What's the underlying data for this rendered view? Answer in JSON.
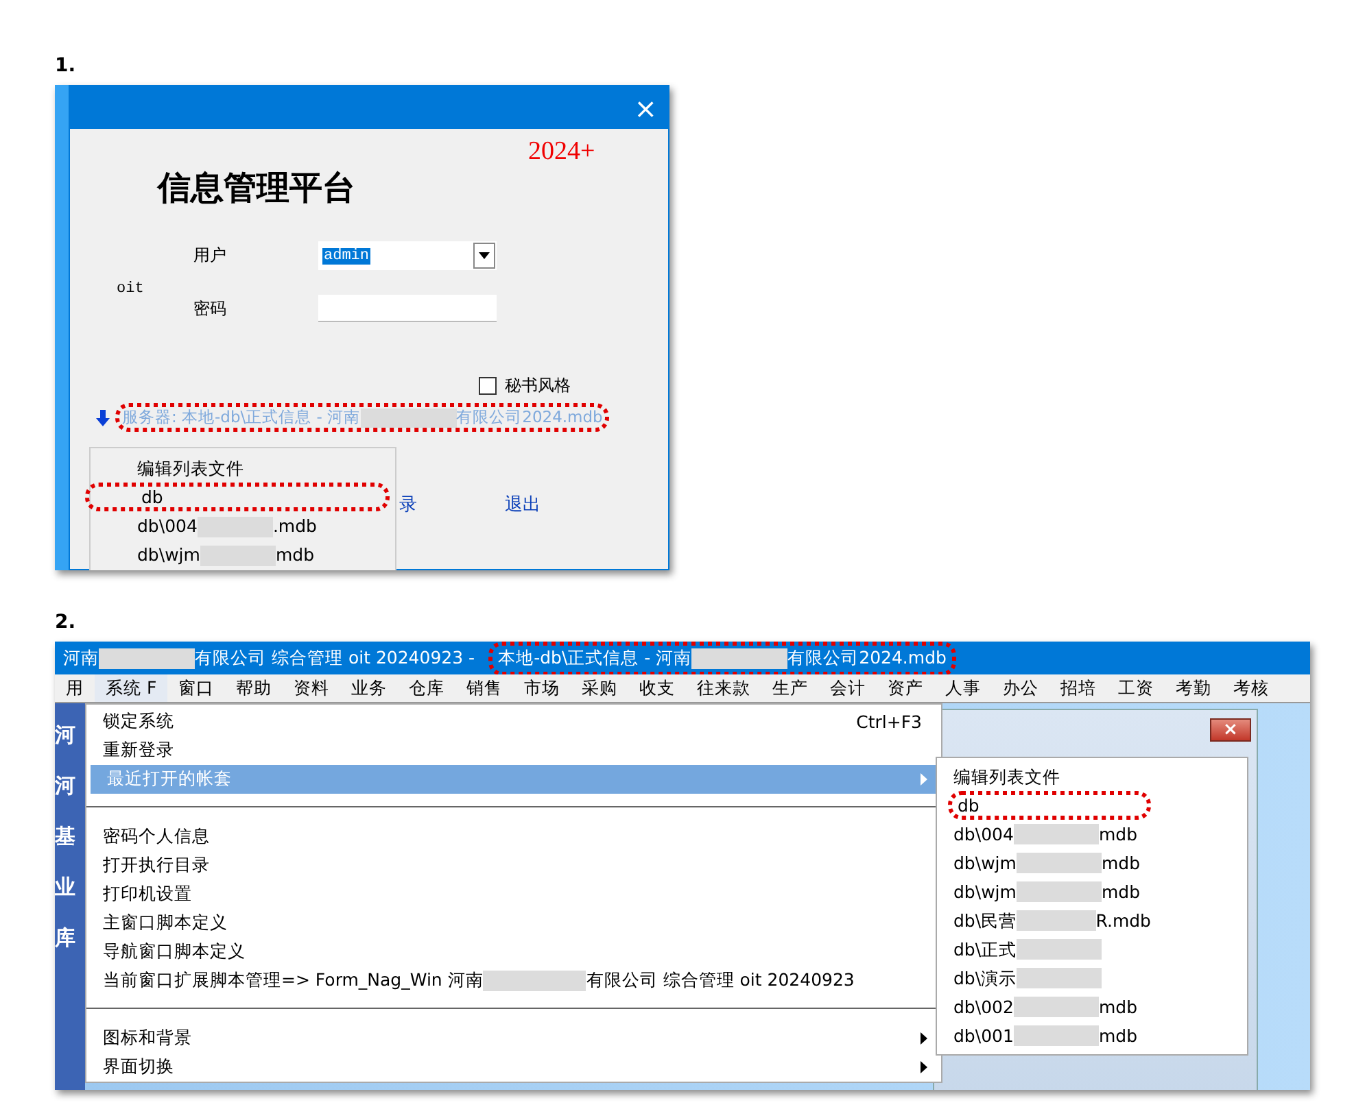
{
  "step_1": {
    "number": "1.",
    "dialog": {
      "close": "×",
      "version": "2024+",
      "title": "信息管理平台",
      "user_label": "用户",
      "user_value": "admin",
      "oit": "oit",
      "password_label": "密码",
      "checkbox": {
        "label": "秘书风格",
        "checked": false
      },
      "server": {
        "highlighted": true,
        "segments": [
          {
            "kind": "text",
            "text": "服务器: 本地-db\\正式信息 - 河南"
          },
          {
            "kind": "redacted"
          },
          {
            "kind": "text",
            "text": "有限公司2024.mdb"
          }
        ]
      },
      "dropdown": [
        {
          "highlighted": false,
          "segments": [
            {
              "kind": "text",
              "text": "编辑列表文件"
            }
          ]
        },
        {
          "highlighted": true,
          "segments": [
            {
              "kind": "text",
              "text": "db"
            }
          ]
        },
        {
          "highlighted": false,
          "segments": [
            {
              "kind": "text",
              "text": "db\\004"
            },
            {
              "kind": "redacted"
            },
            {
              "kind": "text",
              "text": ".mdb"
            }
          ]
        },
        {
          "highlighted": false,
          "segments": [
            {
              "kind": "text",
              "text": "db\\wjm"
            },
            {
              "kind": "redacted"
            },
            {
              "kind": "text",
              "text": "mdb"
            }
          ]
        }
      ],
      "login": "录",
      "exit": "退出"
    }
  },
  "step_2": {
    "number": "2.",
    "title_parts": [
      {
        "highlighted": false,
        "segments": [
          {
            "kind": "text",
            "text": "河南"
          },
          {
            "kind": "redacted"
          },
          {
            "kind": "text",
            "text": "有限公司 综合管理 oit 20240923 -"
          }
        ]
      },
      {
        "highlighted": true,
        "segments": [
          {
            "kind": "text",
            "text": "本地-db\\正式信息 - 河南"
          },
          {
            "kind": "redacted"
          },
          {
            "kind": "text",
            "text": "有限公司2024.mdb"
          }
        ]
      }
    ],
    "menubar": [
      {
        "label": "用",
        "selected": false
      },
      {
        "label": "系统 F",
        "selected": true
      },
      {
        "label": "窗口",
        "selected": false
      },
      {
        "label": "帮助",
        "selected": false
      },
      {
        "label": "资料",
        "selected": false
      },
      {
        "label": "业务",
        "selected": false
      },
      {
        "label": "仓库",
        "selected": false
      },
      {
        "label": "销售",
        "selected": false
      },
      {
        "label": "市场",
        "selected": false
      },
      {
        "label": "采购",
        "selected": false
      },
      {
        "label": "收支",
        "selected": false
      },
      {
        "label": "往来款",
        "selected": false
      },
      {
        "label": "生产",
        "selected": false
      },
      {
        "label": "会计",
        "selected": false
      },
      {
        "label": "资产",
        "selected": false
      },
      {
        "label": "人事",
        "selected": false
      },
      {
        "label": "办公",
        "selected": false
      },
      {
        "label": "招培",
        "selected": false
      },
      {
        "label": "工资",
        "selected": false
      },
      {
        "label": "考勤",
        "selected": false
      },
      {
        "label": "考核",
        "selected": false
      }
    ],
    "sidebar": [
      "河",
      "河",
      "基",
      "业",
      "库"
    ],
    "menu": [
      {
        "kind": "item",
        "selected": false,
        "submenu": false,
        "shortcut": "Ctrl+F3",
        "segments": [
          {
            "kind": "text",
            "text": "锁定系统"
          }
        ]
      },
      {
        "kind": "item",
        "selected": false,
        "submenu": false,
        "segments": [
          {
            "kind": "text",
            "text": "重新登录"
          }
        ]
      },
      {
        "kind": "item",
        "selected": true,
        "submenu": true,
        "segments": [
          {
            "kind": "text",
            "text": "最近打开的帐套"
          }
        ]
      },
      {
        "kind": "separator"
      },
      {
        "kind": "item",
        "selected": false,
        "submenu": false,
        "segments": [
          {
            "kind": "text",
            "text": "密码个人信息"
          }
        ]
      },
      {
        "kind": "item",
        "selected": false,
        "submenu": false,
        "segments": [
          {
            "kind": "text",
            "text": "打开执行目录"
          }
        ]
      },
      {
        "kind": "item",
        "selected": false,
        "submenu": false,
        "segments": [
          {
            "kind": "text",
            "text": "打印机设置"
          }
        ]
      },
      {
        "kind": "item",
        "selected": false,
        "submenu": false,
        "segments": [
          {
            "kind": "text",
            "text": "主窗口脚本定义"
          }
        ]
      },
      {
        "kind": "item",
        "selected": false,
        "submenu": false,
        "segments": [
          {
            "kind": "text",
            "text": "导航窗口脚本定义"
          }
        ]
      },
      {
        "kind": "item",
        "selected": false,
        "submenu": false,
        "segments": [
          {
            "kind": "text",
            "text": "当前窗口扩展脚本管理=> Form_Nag_Win 河南"
          },
          {
            "kind": "redacted"
          },
          {
            "kind": "text",
            "text": "有限公司 综合管理 oit 20240923"
          }
        ]
      },
      {
        "kind": "separator"
      },
      {
        "kind": "item",
        "selected": false,
        "submenu": true,
        "segments": [
          {
            "kind": "text",
            "text": "图标和背景"
          }
        ]
      },
      {
        "kind": "item",
        "selected": false,
        "submenu": true,
        "segments": [
          {
            "kind": "text",
            "text": "界面切换"
          }
        ]
      }
    ],
    "submenu": [
      {
        "highlighted": false,
        "segments": [
          {
            "kind": "text",
            "text": "编辑列表文件"
          }
        ]
      },
      {
        "highlighted": true,
        "segments": [
          {
            "kind": "text",
            "text": "db"
          }
        ]
      },
      {
        "highlighted": false,
        "segments": [
          {
            "kind": "text",
            "text": "db\\004"
          },
          {
            "kind": "redacted"
          },
          {
            "kind": "text",
            "text": "mdb"
          }
        ]
      },
      {
        "highlighted": false,
        "segments": [
          {
            "kind": "text",
            "text": "db\\wjm"
          },
          {
            "kind": "redacted"
          },
          {
            "kind": "text",
            "text": "mdb"
          }
        ]
      },
      {
        "highlighted": false,
        "segments": [
          {
            "kind": "text",
            "text": "db\\wjm"
          },
          {
            "kind": "redacted"
          },
          {
            "kind": "text",
            "text": "mdb"
          }
        ]
      },
      {
        "highlighted": false,
        "segments": [
          {
            "kind": "text",
            "text": "db\\民营"
          },
          {
            "kind": "redacted"
          },
          {
            "kind": "text",
            "text": "R.mdb"
          }
        ]
      },
      {
        "highlighted": false,
        "segments": [
          {
            "kind": "text",
            "text": "db\\正式"
          },
          {
            "kind": "redacted"
          }
        ]
      },
      {
        "highlighted": false,
        "segments": [
          {
            "kind": "text",
            "text": "db\\演示"
          },
          {
            "kind": "redacted"
          }
        ]
      },
      {
        "highlighted": false,
        "segments": [
          {
            "kind": "text",
            "text": "db\\002"
          },
          {
            "kind": "redacted"
          },
          {
            "kind": "text",
            "text": "mdb"
          }
        ]
      },
      {
        "highlighted": false,
        "segments": [
          {
            "kind": "text",
            "text": "db\\001"
          },
          {
            "kind": "redacted"
          },
          {
            "kind": "text",
            "text": "mdb"
          }
        ]
      }
    ],
    "window_close": "×"
  }
}
